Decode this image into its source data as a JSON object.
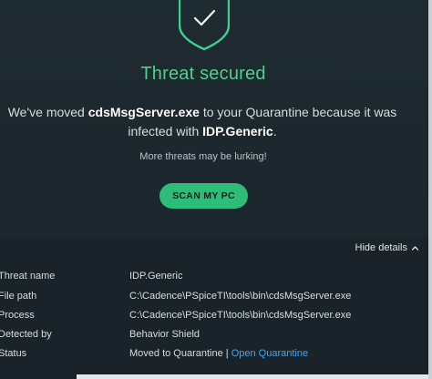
{
  "threat": {
    "title": "Threat secured",
    "message_prefix": "We've moved ",
    "file_name": "cdsMsgServer.exe",
    "message_middle": " to your Quarantine because it was infected with ",
    "infection_name": "IDP.Generic",
    "message_suffix": ".",
    "more_text": "More threats may be lurking!",
    "scan_button": "SCAN MY PC"
  },
  "details": {
    "toggle_label": "Hide details",
    "rows": [
      {
        "label": "Threat name",
        "value": "IDP.Generic"
      },
      {
        "label": "File path",
        "value": "C:\\Cadence\\PSpiceTI\\tools\\bin\\cdsMsgServer.exe"
      },
      {
        "label": "Process",
        "value": "C:\\Cadence\\PSpiceTI\\tools\\bin\\cdsMsgServer.exe"
      },
      {
        "label": "Detected by",
        "value": "Behavior Shield"
      },
      {
        "label": "Status",
        "value": "Moved to Quarantine | ",
        "link": "Open Quarantine"
      }
    ]
  },
  "icons": {
    "shield": "shield-check-icon",
    "toggle": "chevron-up-icon"
  },
  "colors": {
    "background": "#1e2b31",
    "details_background": "#1a2329",
    "accent_green": "#4fd08a",
    "button_green": "#2ebd78",
    "link_blue": "#37a9ff"
  }
}
